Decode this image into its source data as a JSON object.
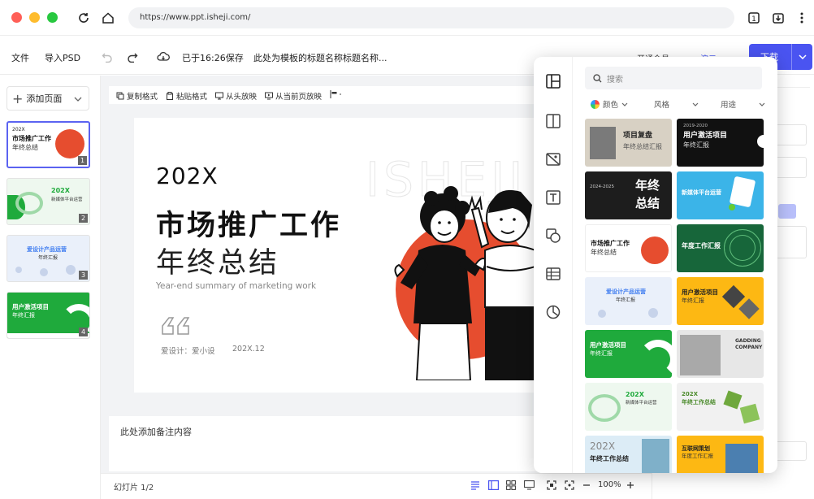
{
  "browser": {
    "url": "https://www.ppt.isheji.com/",
    "icons": [
      "reload-icon",
      "home-icon",
      "tab-icon",
      "install-icon",
      "more-icon"
    ]
  },
  "toolbar": {
    "file": "文件",
    "import_psd": "导入PSD",
    "saved_status": "已于16:26保存",
    "doc_title": "此处为模板的标题名称标题名称...",
    "member": "开通会员",
    "present": "演示",
    "download": "下载",
    "accent_color": "#4a54f1"
  },
  "slides_panel": {
    "add_page": "添加页面",
    "thumbs": [
      {
        "num": "1",
        "title": "市场推广工作",
        "sub": "年终总结",
        "year": "202X"
      },
      {
        "num": "2",
        "title": "202X",
        "sub": "新媒体平台运营"
      },
      {
        "num": "3",
        "title": "爱设计产品运营",
        "sub": "年终汇报"
      },
      {
        "num": "4",
        "title": "用户激活项目",
        "sub": "年终汇报"
      }
    ]
  },
  "edit_toolbar": {
    "copy_format": "复制格式",
    "paste_format": "粘贴格式",
    "play_from_start": "从头放映",
    "play_from_current": "从当前页放映"
  },
  "slide": {
    "year": "202X",
    "title": "市场推广工作",
    "subtitle": "年终总结",
    "english": "Year-end summary of marketing work",
    "author": "爱设计：爱小设",
    "date": "202X.12",
    "watermark": "ISHEJI"
  },
  "notes": {
    "placeholder": "此处添加备注内容"
  },
  "statusbar": {
    "slide_count": "幻灯片 1/2",
    "zoom": "100%"
  },
  "template_panel": {
    "search_placeholder": "搜索",
    "filters": {
      "color": "颜色",
      "style": "风格",
      "usage": "用途"
    },
    "templates": [
      {
        "title": "项目复盘",
        "sub": "年终总结汇报"
      },
      {
        "title": "用户激活项目",
        "sub": "年终汇报",
        "year": "2019-2020"
      },
      {
        "title": "年终",
        "title2": "总结",
        "year": "2024-2025"
      },
      {
        "title": "新媒体平台运营",
        "sub": ""
      },
      {
        "title": "市场推广工作",
        "sub": "年终总结"
      },
      {
        "title": "年度工作汇报",
        "sub": ""
      },
      {
        "title": "爱设计产品运营",
        "sub": "年终汇报"
      },
      {
        "title": "用户激活项目",
        "sub": "年终汇报"
      },
      {
        "title": "用户激活项目",
        "sub": "年终汇报"
      },
      {
        "title": "GADDING",
        "sub": "COMPANY"
      },
      {
        "title": "202X",
        "sub": "新媒体平台运营"
      },
      {
        "title": "202X",
        "sub": "年终工作总结"
      },
      {
        "title": "202X",
        "sub": "年终工作总结"
      },
      {
        "title": "互联网策划",
        "sub": "年度工作汇报"
      }
    ]
  }
}
